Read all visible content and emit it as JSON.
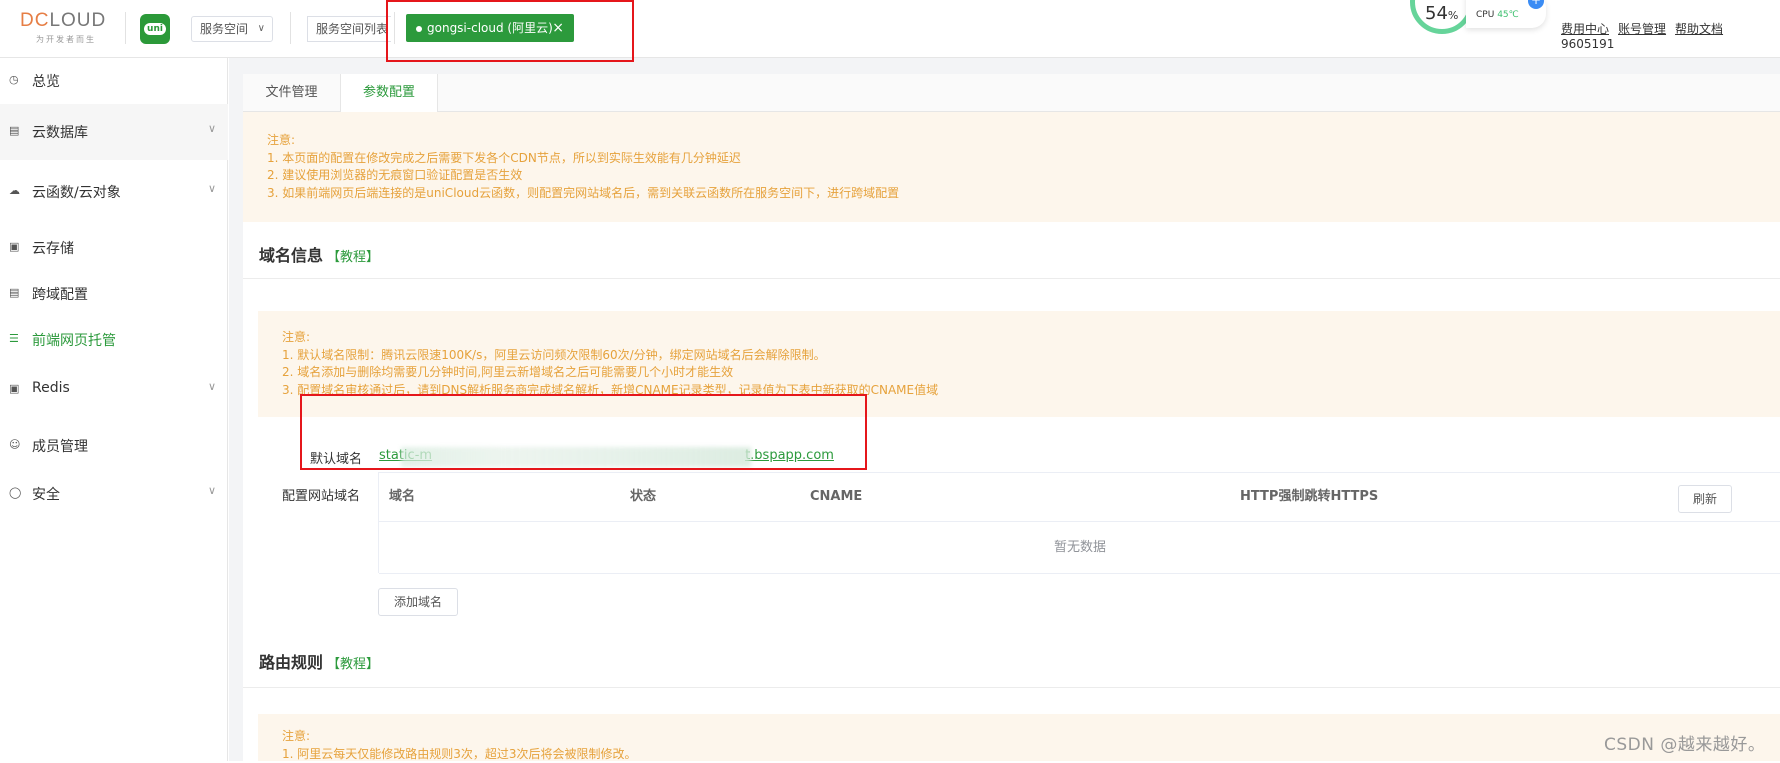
{
  "header": {
    "brand": "DCLOUD",
    "slogan": "为开发者而生",
    "uni_label": "uni",
    "space_select": "服务空间",
    "space_list": "服务空间列表",
    "active_space": "gongsi-cloud (阿里云)",
    "close_glyph": "×",
    "gauge_value": "54",
    "gauge_unit": "%",
    "cpu_label": "CPU",
    "cpu_temp": "45℃",
    "links": [
      "费用中心",
      "账号管理",
      "帮助文档"
    ],
    "user_id": "9605191"
  },
  "sidebar": {
    "items": [
      {
        "label": "总览",
        "icon": "clock-icon"
      },
      {
        "label": "云数据库",
        "icon": "database-icon"
      },
      {
        "label": "云函数/云对象",
        "icon": "cloud-icon"
      },
      {
        "label": "云存储",
        "icon": "storage-icon"
      },
      {
        "label": "跨域配置",
        "icon": "cors-icon"
      },
      {
        "label": "前端网页托管",
        "icon": "hosting-icon"
      },
      {
        "label": "Redis",
        "icon": "redis-icon"
      },
      {
        "label": "成员管理",
        "icon": "user-icon"
      },
      {
        "label": "安全",
        "icon": "shield-icon"
      }
    ]
  },
  "tabs": [
    {
      "label": "文件管理",
      "active": false
    },
    {
      "label": "参数配置",
      "active": true
    }
  ],
  "notice_top": {
    "title": "注意:",
    "lines": [
      "1. 本页面的配置在修改完成之后需要下发各个CDN节点，所以到实际生效能有几分钟延迟",
      "2. 建议使用浏览器的无痕窗口验证配置是否生效",
      "3. 如果前端网页后端连接的是uniCloud云函数，则配置完网站域名后，需到关联云函数所在服务空间下，进行跨域配置"
    ]
  },
  "domain_section": {
    "title": "域名信息",
    "tutorial": "【教程】",
    "notice_title": "注意:",
    "notice_lines": [
      "1. 默认域名限制：腾讯云限速100K/s，阿里云访问频次限制60次/分钟，绑定网站域名后会解除限制。",
      "2. 域名添加与删除均需要几分钟时间,阿里云新增域名之后可能需要几个小时才能生效",
      "3. 配置域名审核通过后，请到DNS解析服务商完成域名解析，新增CNAME记录类型，记录值为下表中新获取的CNAME值域"
    ],
    "default_domain_label": "默认域名",
    "default_domain_prefix": "static-m",
    "default_domain_suffix": "t.bspapp.com",
    "site_domain_label": "配置网站域名",
    "table_headers": [
      "域名",
      "状态",
      "CNAME",
      "HTTP强制跳转HTTPS"
    ],
    "refresh_button": "刷新",
    "empty_text": "暂无数据",
    "add_button": "添加域名"
  },
  "route_section": {
    "title": "路由规则",
    "tutorial": "【教程】",
    "notice_title": "注意:",
    "notice_line": "1. 阿里云每天仅能修改路由规则3次，超过3次后将会被限制修改。"
  },
  "watermark": "CSDN @越来越好。",
  "colors": {
    "primary_green": "#2c9a3c",
    "warning_orange": "#e6a23c",
    "notice_bg": "#fdf6ec",
    "annotation_red": "#e5161b"
  }
}
